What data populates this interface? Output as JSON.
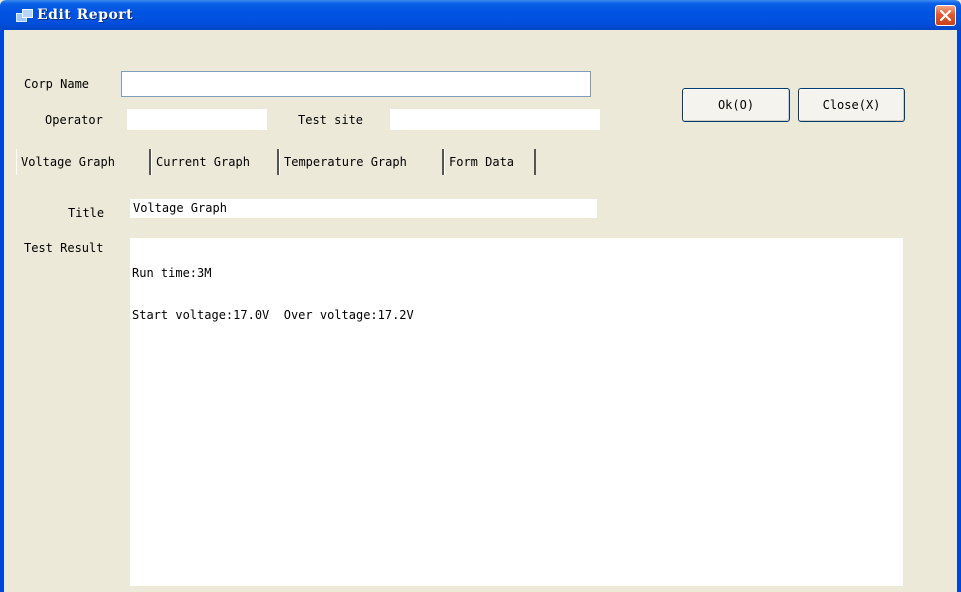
{
  "window": {
    "title": "Edit Report",
    "icon": "app-window-icon",
    "close_icon": "close-icon"
  },
  "form": {
    "corp_name_label": "Corp Name",
    "corp_name_value": "",
    "operator_label": "Operator",
    "operator_value": "",
    "test_site_label": "Test site",
    "test_site_value": ""
  },
  "buttons": {
    "ok_label": "Ok(O)",
    "close_label": "Close(X)"
  },
  "tabs": [
    {
      "label": "Voltage Graph",
      "selected": true
    },
    {
      "label": "Current Graph",
      "selected": false
    },
    {
      "label": "Temperature Graph",
      "selected": false
    },
    {
      "label": "Form Data",
      "selected": false
    }
  ],
  "panel": {
    "title_label": "Title",
    "title_value": "Voltage Graph",
    "result_label": "Test Result",
    "result_lines": [
      "Run time:3M",
      "Start voltage:17.0V  Over voltage:17.2V"
    ]
  },
  "colors": {
    "titlebar": "#0054e3",
    "window_bg": "#ece9d8",
    "close_button": "#e3572c"
  }
}
